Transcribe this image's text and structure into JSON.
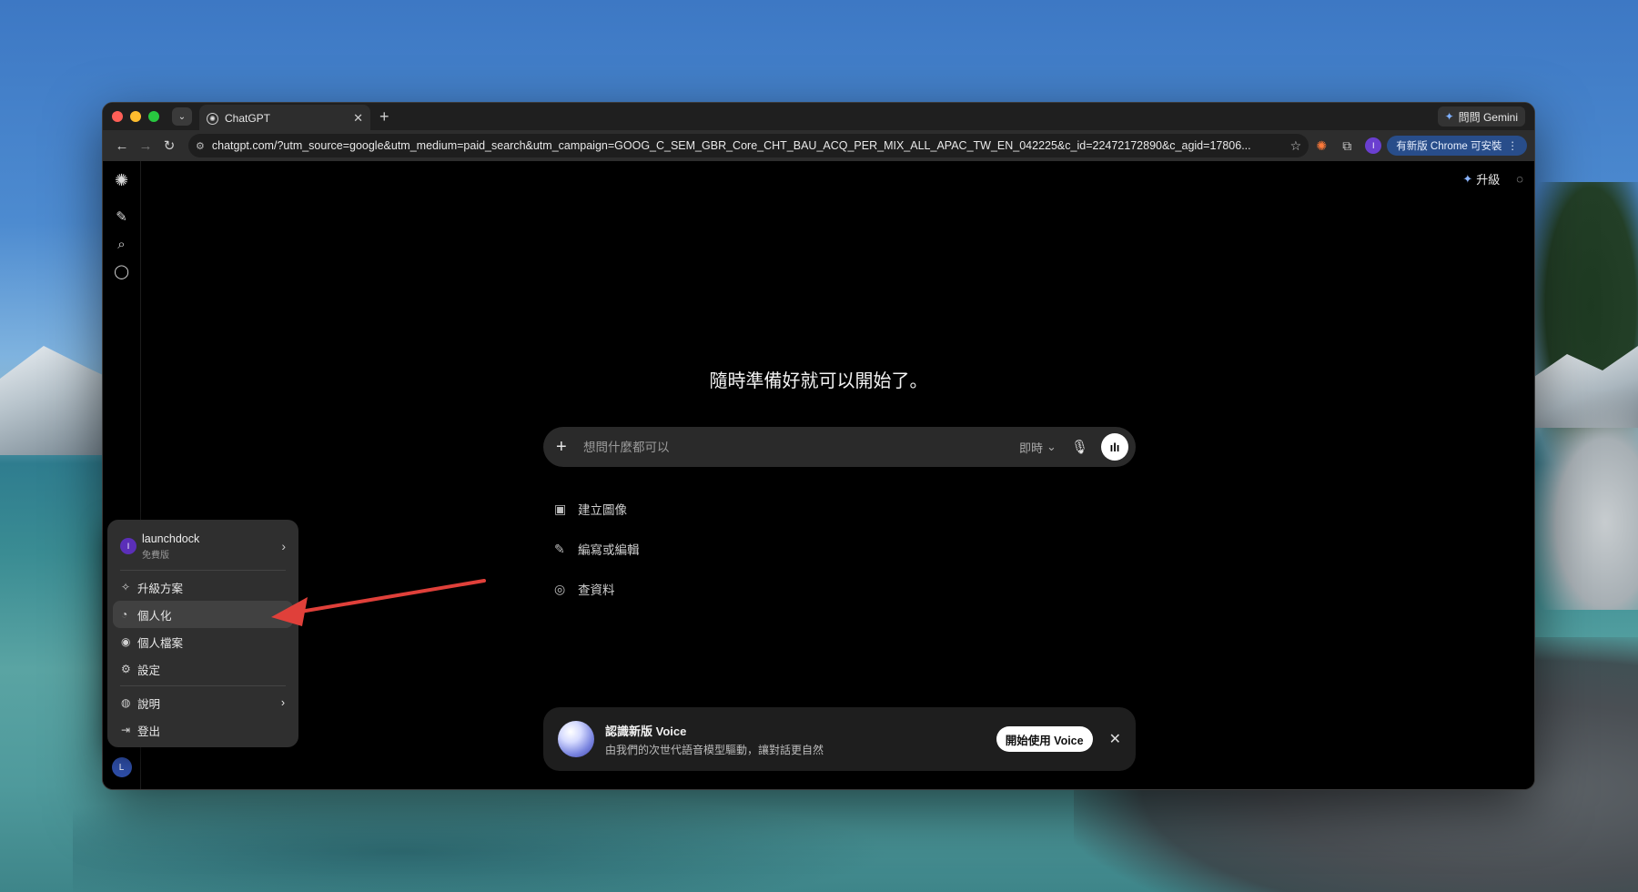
{
  "browser": {
    "tab_title": "ChatGPT",
    "gemini_label": "問問 Gemini",
    "url": "chatgpt.com/?utm_source=google&utm_medium=paid_search&utm_campaign=GOOG_C_SEM_GBR_Core_CHT_BAU_ACQ_PER_MIX_ALL_APAC_TW_EN_042225&c_id=22472172890&c_agid=17806...",
    "profile_initial": "I",
    "update_label": "有新版 Chrome 可安裝"
  },
  "header": {
    "upgrade_label": "升級"
  },
  "main": {
    "headline": "隨時準備好就可以開始了。",
    "composer_placeholder": "想問什麼都可以",
    "mode_label": "即時",
    "suggestions": [
      {
        "label": "建立圖像",
        "icon": "image-icon"
      },
      {
        "label": "編寫或編輯",
        "icon": "pencil-icon"
      },
      {
        "label": "查資料",
        "icon": "globe-icon"
      }
    ]
  },
  "voice_banner": {
    "title": "認識新版 Voice",
    "subtitle": "由我們的次世代語音模型驅動，讓對話更自然",
    "button": "開始使用 Voice"
  },
  "account_menu": {
    "user_initial": "I",
    "user_name": "launchdock",
    "user_plan": "免費版",
    "items": [
      {
        "label": "升級方案",
        "icon": "sparkle-icon"
      },
      {
        "label": "個人化",
        "icon": "personalize-icon",
        "active": true
      },
      {
        "label": "個人檔案",
        "icon": "profile-icon"
      },
      {
        "label": "設定",
        "icon": "gear-icon"
      },
      {
        "label": "說明",
        "icon": "help-icon"
      },
      {
        "label": "登出",
        "icon": "logout-icon"
      }
    ]
  },
  "sidebar": {
    "avatar_initial": "L"
  },
  "colors": {
    "accent_arrow": "#e0403a",
    "profile_purple": "#5b2fb8",
    "avatar_blue": "#2e4ea8"
  }
}
